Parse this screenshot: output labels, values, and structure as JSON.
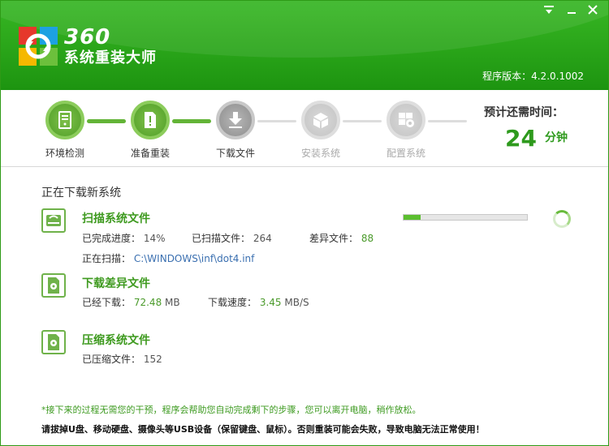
{
  "window": {
    "brand_number": "360",
    "brand_title": "系统重装大师",
    "version_label": "程序版本：",
    "version_value": "4.2.0.1002",
    "controls": {
      "menu_icon": "menu-icon",
      "minimize_icon": "minimize-icon",
      "close_icon": "close-icon"
    }
  },
  "steps": [
    {
      "label": "环境检测",
      "state": "done",
      "icon": "computer-icon"
    },
    {
      "label": "准备重装",
      "state": "done",
      "icon": "document-alert-icon"
    },
    {
      "label": "下载文件",
      "state": "active",
      "icon": "download-icon"
    },
    {
      "label": "安装系统",
      "state": "todo",
      "icon": "install-box-icon"
    },
    {
      "label": "配置系统",
      "state": "todo",
      "icon": "windows-gear-icon"
    }
  ],
  "time": {
    "label": "预计还需时间：",
    "value": "24",
    "unit": "分钟"
  },
  "main": {
    "section_title": "正在下载新系统",
    "scan": {
      "title": "扫描系统文件",
      "progress_label": "已完成进度：",
      "progress_value": "14%",
      "progress_fraction": 0.14,
      "scanned_label": "已扫描文件：",
      "scanned_value": "264",
      "diff_label": "差异文件：",
      "diff_value": "88",
      "scanning_label": "正在扫描：",
      "scanning_path": "C:\\WINDOWS\\inf\\dot4.inf"
    },
    "download": {
      "title": "下载差异文件",
      "downloaded_label": "已经下载：",
      "downloaded_value": "72.48",
      "downloaded_unit": "MB",
      "speed_label": "下载速度：",
      "speed_value": "3.45",
      "speed_unit": "MB/S"
    },
    "compress": {
      "title": "压缩系统文件",
      "compressed_label": "已压缩文件：",
      "compressed_value": "152"
    }
  },
  "notes": {
    "note1": "*接下来的过程无需您的干预，程序会帮助您自动完成剩下的步骤，您可以离开电脑，稍作放松。",
    "note2": "请拔掉U盘、移动硬盘、摄像头等USB设备（保留键盘、鼠标）。否则重装可能会失败，导致电脑无法正常使用！"
  },
  "colors": {
    "brand_green": "#2ca81b",
    "accent_green": "#3e9a1f",
    "link_blue": "#3a6fb0"
  }
}
